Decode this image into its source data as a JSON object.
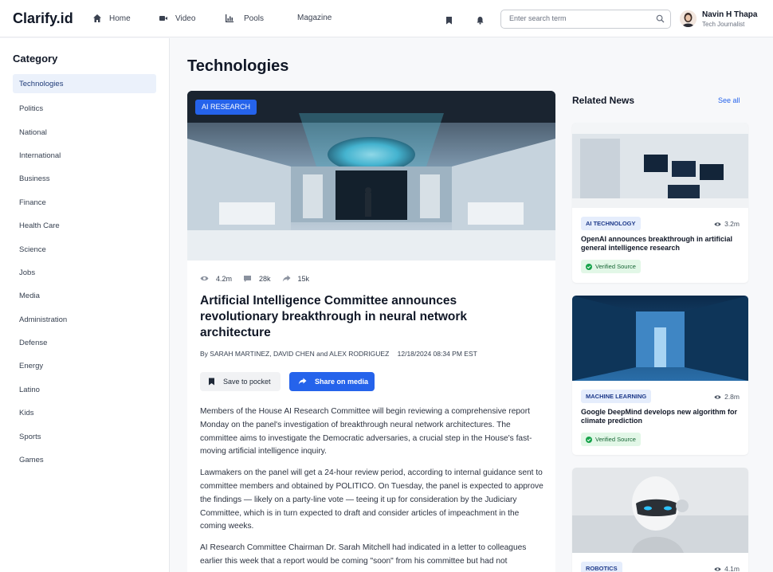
{
  "app": {
    "logo": "Clarify.id"
  },
  "nav": {
    "items": [
      {
        "label": "Home",
        "icon": "home-icon"
      },
      {
        "label": "Video",
        "icon": "video-icon"
      },
      {
        "label": "Pools",
        "icon": "chart-icon"
      },
      {
        "label": "Magazine",
        "icon": ""
      }
    ]
  },
  "search": {
    "placeholder": "Enter search term"
  },
  "user": {
    "name": "Navin H Thapa",
    "role": "Tech Journalist"
  },
  "sidebar": {
    "title": "Category",
    "items": [
      "Technologies",
      "Politics",
      "National",
      "International",
      "Business",
      "Finance",
      "Health Care",
      "Science",
      "Jobs",
      "Media",
      "Administration",
      "Defense",
      "Energy",
      "Latino",
      "Kids",
      "Sports",
      "Games"
    ],
    "active": "Technologies"
  },
  "page": {
    "title": "Technologies"
  },
  "article": {
    "tag": "AI RESEARCH",
    "views": "4.2m",
    "comments": "28k",
    "shares": "15k",
    "headline": "Artificial Intelligence Committee announces revolutionary breakthrough in neural network architecture",
    "byline": "By SARAH MARTINEZ, DAVID CHEN and ALEX RODRIGUEZ",
    "date": "12/18/2024 08:34 PM EST",
    "save_label": "Save to pocket",
    "share_label": "Share on media",
    "paragraphs": [
      "Members of the House AI Research Committee will begin reviewing a comprehensive report Monday on the panel's investigation of breakthrough neural network architectures. The committee aims to investigate the Democratic adversaries, a crucial step in the House's fast-moving artificial intelligence inquiry.",
      "Lawmakers on the panel will get a 24-hour review period, according to internal guidance sent to committee members and obtained by POLITICO. On Tuesday, the panel is expected to approve the findings — likely on a party-line vote — teeing it up for consideration by the Judiciary Committee, which is in turn expected to draft and consider articles of impeachment in the coming weeks.",
      "AI Research Committee Chairman Dr. Sarah Mitchell had indicated in a letter to colleagues earlier this week that a report would be coming \"soon\" from his committee but had not"
    ]
  },
  "related": {
    "title": "Related News",
    "see_all": "See all",
    "cards": [
      {
        "tag": "AI TECHNOLOGY",
        "views": "3.2m",
        "title": "OpenAI announces breakthrough in artificial general intelligence research",
        "badge": "Verified Source"
      },
      {
        "tag": "MACHINE LEARNING",
        "views": "2.8m",
        "title": "Google DeepMind develops new algorithm for climate prediction",
        "badge": "Verified Source"
      },
      {
        "tag": "ROBOTICS",
        "views": "4.1m",
        "title": "",
        "badge": ""
      }
    ]
  },
  "colors": {
    "accent": "#2563eb",
    "verified_bg": "#e2f7e7",
    "tag_bg": "#e5edfc"
  }
}
